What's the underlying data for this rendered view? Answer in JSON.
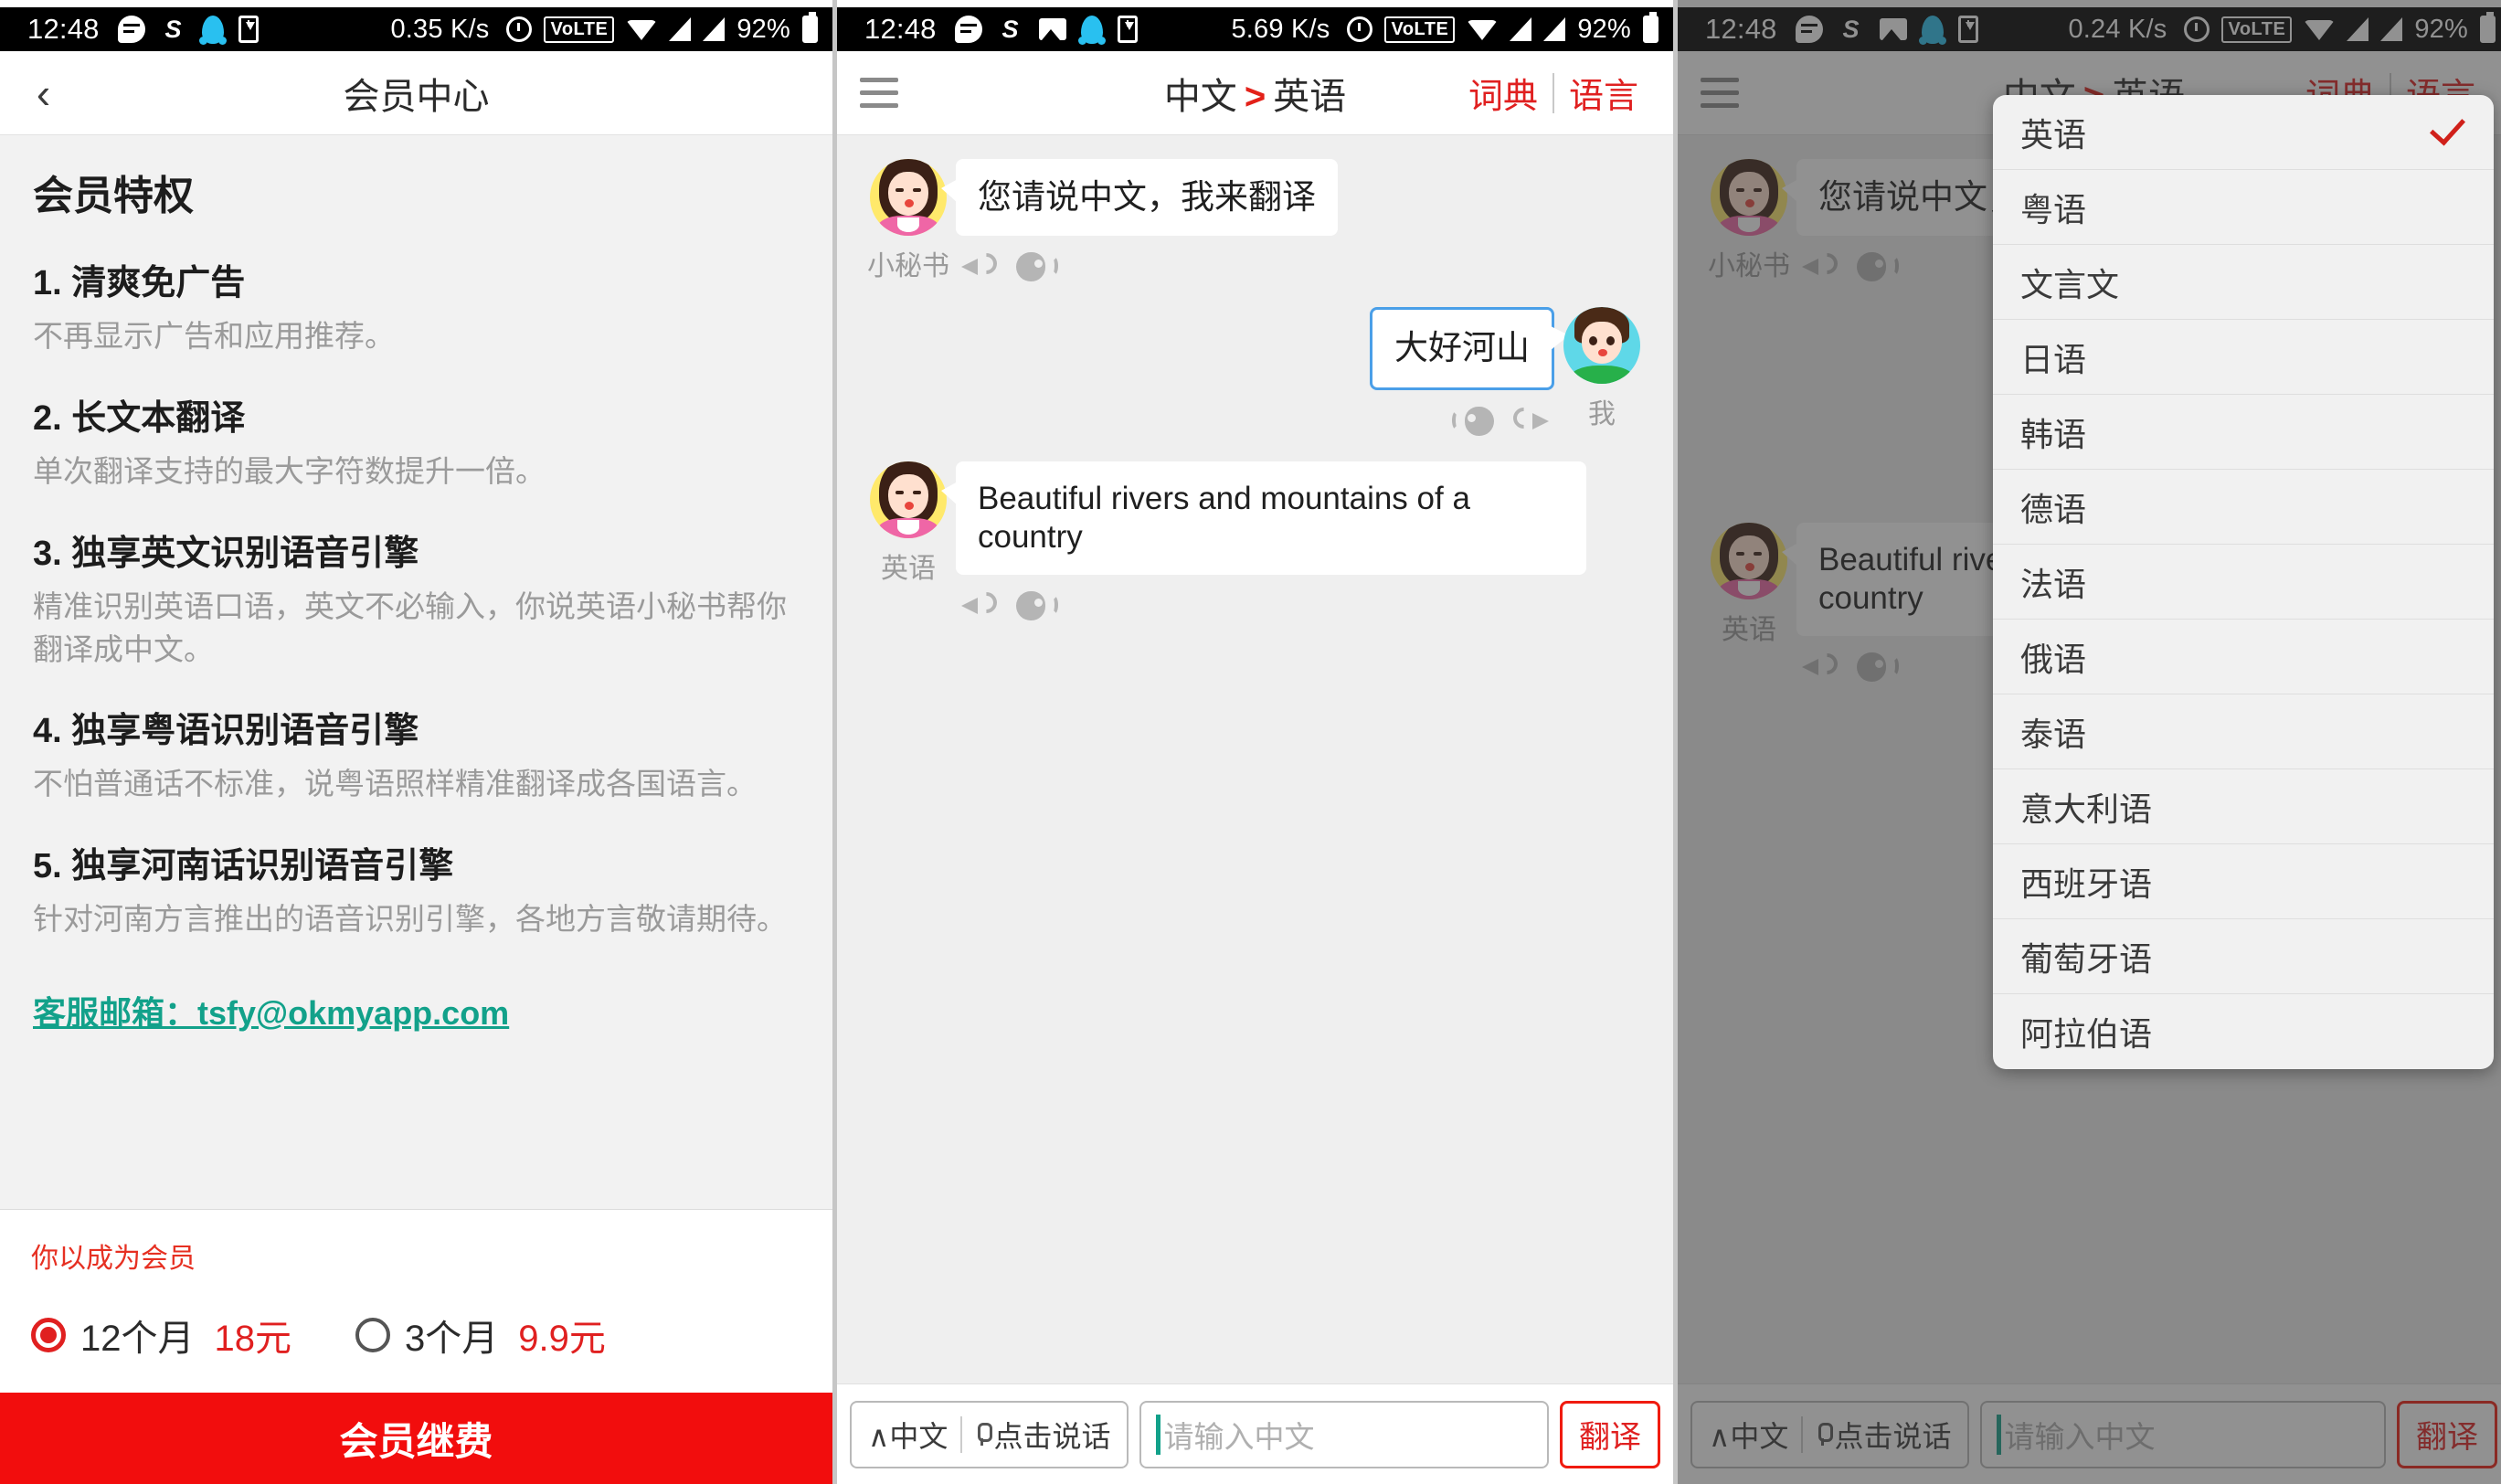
{
  "status_bar": {
    "time": "12:48",
    "net_speed_1": "0.35 K/s",
    "net_speed_2": "5.69 K/s",
    "net_speed_3": "0.24 K/s",
    "battery": "92%",
    "volte": "VoLTE",
    "icons": [
      "message-icon",
      "sogou-icon",
      "gallery-icon",
      "qq-icon",
      "download-icon",
      "alarm-icon",
      "volte-icon",
      "wifi-icon",
      "signal-icon",
      "signal-icon",
      "battery-icon"
    ]
  },
  "member_page": {
    "nav": {
      "back": "‹",
      "title": "会员中心"
    },
    "heading": "会员特权",
    "privileges": [
      {
        "title": "1. 清爽免广告",
        "desc": "不再显示广告和应用推荐。"
      },
      {
        "title": "2. 长文本翻译",
        "desc": "单次翻译支持的最大字符数提升一倍。"
      },
      {
        "title": "3. 独享英文识别语音引擎",
        "desc": "精准识别英语口语，英文不必输入，你说英语小秘书帮你翻译成中文。"
      },
      {
        "title": "4. 独享粤语识别语音引擎",
        "desc": "不怕普通话不标准，说粤语照样精准翻译成各国语言。"
      },
      {
        "title": "5. 独享河南话识别语音引擎",
        "desc": "针对河南方言推出的语音识别引擎，各地方言敬请期待。"
      }
    ],
    "support_email": "客服邮箱：tsfy@okmyapp.com",
    "member_note": "你以成为会员",
    "plans": [
      {
        "label": "12个月",
        "price": "18元",
        "selected": true
      },
      {
        "label": "3个月",
        "price": "9.9元",
        "selected": false
      }
    ],
    "cta": "会员继费"
  },
  "translate_page": {
    "nav": {
      "menu_icon": "hamburger-icon",
      "source_lang": "中文",
      "arrow": ">",
      "target_lang": "英语",
      "action_dict": "词典",
      "action_lang": "语言"
    },
    "messages": [
      {
        "speaker": "小秘书",
        "side": "left",
        "text": "您请说中文，我来翻译",
        "avatar": "female-avatar"
      },
      {
        "speaker": "我",
        "side": "right",
        "text": "大好河山",
        "avatar": "male-avatar"
      },
      {
        "speaker": "英语",
        "side": "left",
        "text": "Beautiful rivers and mountains of a country",
        "avatar": "female-avatar"
      }
    ],
    "input_bar": {
      "lang_toggle": "中文",
      "lang_caret": "∧",
      "speak_button": "点击说话",
      "placeholder": "请输入中文",
      "value": "",
      "translate_button": "翻译"
    }
  },
  "language_dropdown": {
    "selected": "英语",
    "items": [
      "英语",
      "粤语",
      "文言文",
      "日语",
      "韩语",
      "德语",
      "法语",
      "俄语",
      "泰语",
      "意大利语",
      "西班牙语",
      "葡萄牙语",
      "阿拉伯语"
    ]
  },
  "colors": {
    "accent_red": "#e02020",
    "cta_red": "#f20d0d",
    "teal_link": "#12a18a",
    "chat_bg": "#efefef",
    "mine_border": "#4a9fe8"
  }
}
